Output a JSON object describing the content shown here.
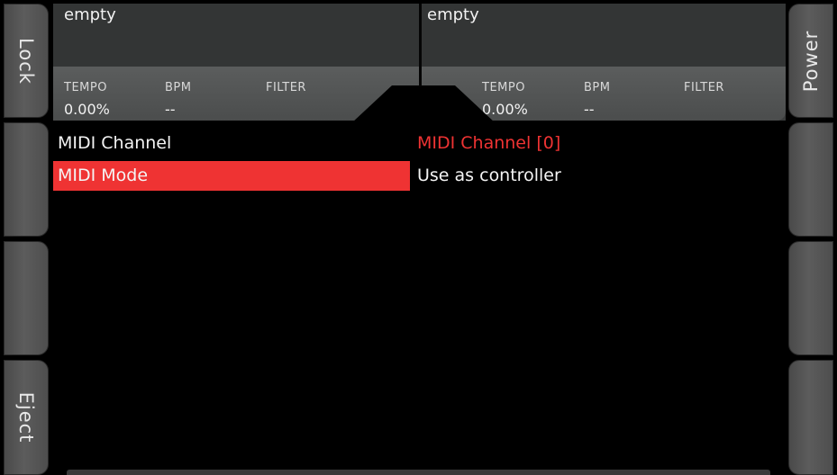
{
  "side_buttons": {
    "left": [
      {
        "label": "Lock"
      },
      {
        "label": ""
      },
      {
        "label": ""
      },
      {
        "label": "Eject"
      }
    ],
    "right": [
      {
        "label": "Power"
      },
      {
        "label": ""
      },
      {
        "label": ""
      },
      {
        "label": ""
      }
    ]
  },
  "decks": {
    "left": {
      "title": "empty",
      "tempo_label": "TEMPO",
      "tempo_value": "0.00%",
      "bpm_label": "BPM",
      "bpm_value": "--",
      "filter_label": "FILTER"
    },
    "right": {
      "title": "empty",
      "tempo_label": "TEMPO",
      "tempo_value": "0.00%",
      "bpm_label": "BPM",
      "bpm_value": "--",
      "filter_label": "FILTER"
    }
  },
  "menu": {
    "items": [
      {
        "label": "MIDI Channel",
        "value": "MIDI Channel [0]"
      },
      {
        "label": "MIDI Mode",
        "value": "Use as controller"
      }
    ],
    "selected_index": 1
  },
  "colors": {
    "accent": "#ef3333",
    "panel": "#3a3c3c",
    "background": "#000000"
  }
}
